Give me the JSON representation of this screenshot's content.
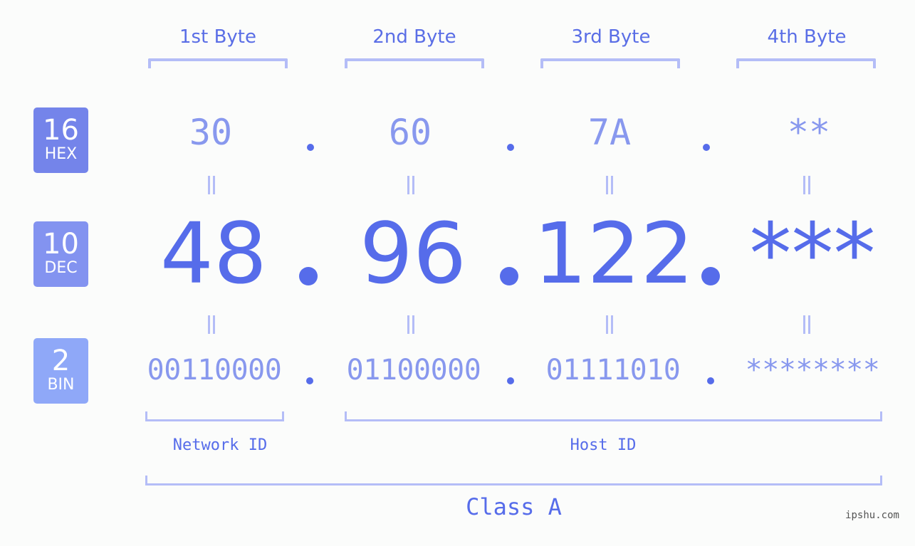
{
  "headers": [
    "1st Byte",
    "2nd Byte",
    "3rd Byte",
    "4th Byte"
  ],
  "badges": {
    "hex": {
      "num": "16",
      "label": "HEX"
    },
    "dec": {
      "num": "10",
      "label": "DEC"
    },
    "bin": {
      "num": "2",
      "label": "BIN"
    }
  },
  "hex": [
    "30",
    "60",
    "7A",
    "**"
  ],
  "dec": [
    "48",
    "96",
    "122",
    "***"
  ],
  "bin": [
    "00110000",
    "01100000",
    "01111010",
    "********"
  ],
  "labels": {
    "network_id": "Network ID",
    "host_id": "Host ID",
    "class": "Class A"
  },
  "watermark": "ipshu.com",
  "colors": {
    "accent": "#566cea",
    "light_accent": "#8898ee",
    "bracket": "#b4bdf7",
    "hex_badge": "#7484ea",
    "dec_badge": "#8393f0",
    "bin_badge": "#8fa8f8"
  }
}
